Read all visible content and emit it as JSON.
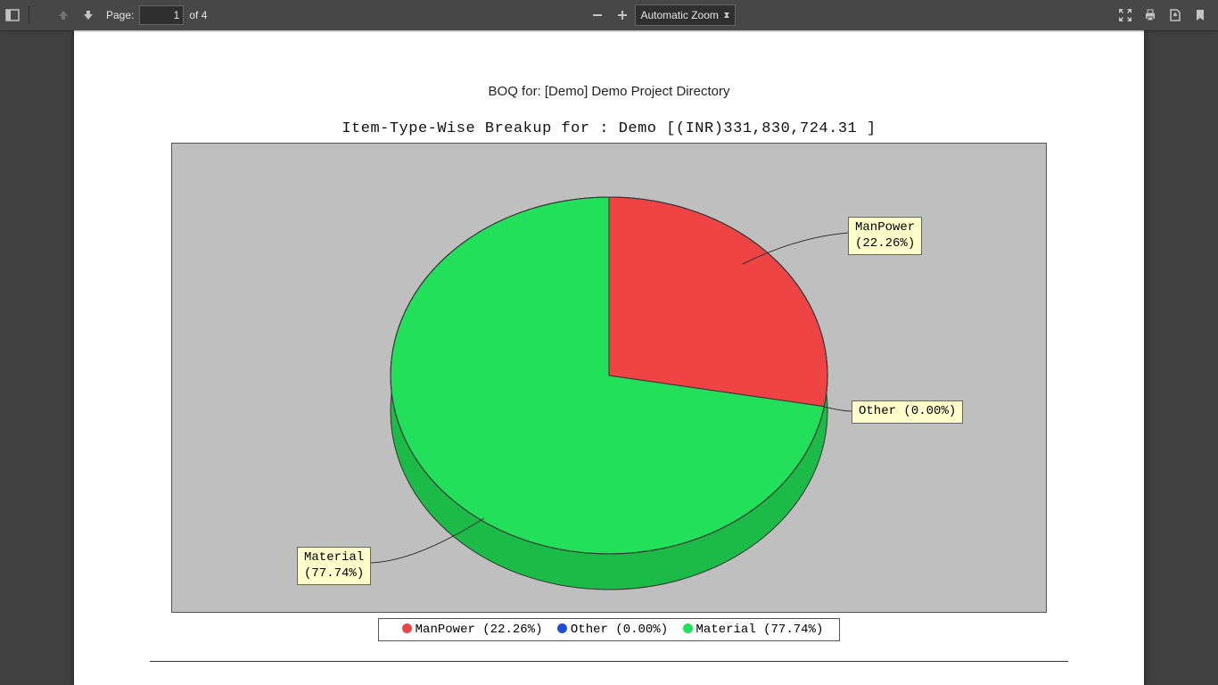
{
  "toolbar": {
    "page_label": "Page:",
    "page_input": "1",
    "page_total": "of 4",
    "zoom_label": "Automatic Zoom"
  },
  "doc": {
    "title": "BOQ for: [Demo] Demo Project Directory"
  },
  "chart_data": {
    "type": "pie",
    "title": "Item-Type-Wise Breakup for : Demo [(INR)331,830,724.31 ]",
    "series": [
      {
        "name": "ManPower",
        "value": 22.26,
        "color": "#ef4444",
        "label": "ManPower\n(22.26%)"
      },
      {
        "name": "Other",
        "value": 0.0,
        "color": "#1d4ed8",
        "label": "Other (0.00%)"
      },
      {
        "name": "Material",
        "value": 77.74,
        "color": "#22e05a",
        "label": "Material\n(77.74%)"
      }
    ],
    "legend": [
      {
        "text": "ManPower (22.26%)",
        "color": "#ef4444"
      },
      {
        "text": "Other (0.00%)",
        "color": "#1d4ed8"
      },
      {
        "text": "Material (77.74%)",
        "color": "#22e05a"
      }
    ]
  }
}
